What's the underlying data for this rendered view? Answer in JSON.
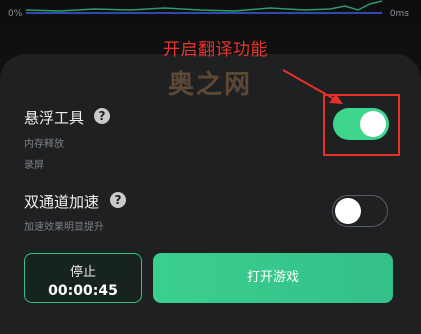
{
  "graph": {
    "left_label": "0%",
    "right_label": "0ms"
  },
  "annotation": {
    "text": "开启翻译功能",
    "color": "#e8352d"
  },
  "watermark": {
    "text": "奥之网"
  },
  "settings": [
    {
      "title": "悬浮工具",
      "subtitles": [
        "内存释放",
        "录屏"
      ],
      "help_icon": "?",
      "toggle_on": true
    },
    {
      "title": "双通道加速",
      "subtitles": [
        "加速效果明显提升"
      ],
      "help_icon": "?",
      "toggle_on": false
    }
  ],
  "stop": {
    "label": "停止",
    "timer": "00:00:45"
  },
  "open_game": {
    "label": "打开游戏"
  },
  "colors": {
    "accent": "#3dd68c",
    "panel": "#1f2022",
    "highlight": "#e53128"
  }
}
